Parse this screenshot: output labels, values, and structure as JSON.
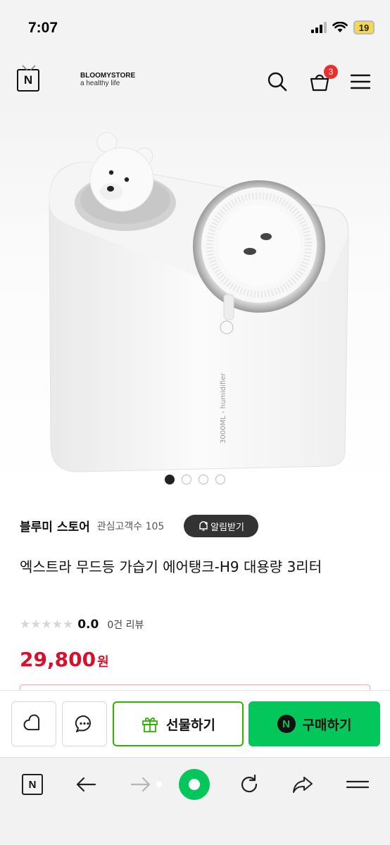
{
  "status_bar": {
    "time": "7:07",
    "battery": "19"
  },
  "header": {
    "logo": "N",
    "brand_line1": "BLOOMYSTORE",
    "brand_line2": "a healthy life",
    "cart_count": "3"
  },
  "product": {
    "image_text": "3000ML - humidifier",
    "slide_count": 4,
    "active_slide": 1,
    "store_name": "블루미 스토어",
    "fans_label": "관심고객수 105",
    "alarm_label": "알림받기",
    "title": "엑스트라 무드등 가습기 에어탱크-H9 대용량 3리터",
    "stars": "★★★★★",
    "rating": "0.0",
    "review_count": "0건 리뷰",
    "price": "29,800",
    "price_unit": "원"
  },
  "action_bar": {
    "gift_label": "선물하기",
    "buy_label": "구매하기",
    "buy_badge": "N"
  },
  "browser_toolbar": {
    "home_label": "N"
  },
  "colors": {
    "naver_green": "#03c75a",
    "price_red": "#d6102d",
    "badge_red": "#e8312f"
  }
}
